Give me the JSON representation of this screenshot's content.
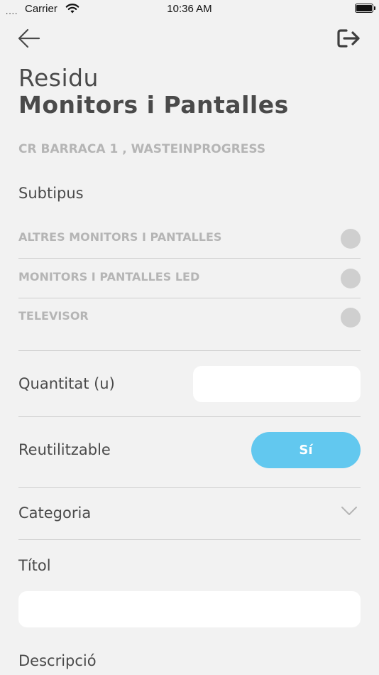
{
  "status_bar": {
    "signal": "....",
    "carrier": "Carrier",
    "time": "10:36 AM"
  },
  "header": {
    "back_icon": "arrow-left-icon",
    "logout_icon": "logout-icon"
  },
  "title": {
    "line1": "Residu",
    "line2": "Monitors i Pantalles"
  },
  "address": "CR BARRACA 1 , WASTEINPROGRESS",
  "subtypes": {
    "label": "Subtipus",
    "items": [
      {
        "label": "ALTRES MONITORS I PANTALLES",
        "selected": false
      },
      {
        "label": "MONITORS I PANTALLES LED",
        "selected": false
      },
      {
        "label": "TELEVISOR",
        "selected": false
      }
    ]
  },
  "quantity": {
    "label": "Quantitat (u)",
    "value": ""
  },
  "reusable": {
    "label": "Reutilitzable",
    "value": "Sí",
    "color": "#62c8ef"
  },
  "category": {
    "label": "Categoria",
    "icon": "chevron-down-icon"
  },
  "title_field": {
    "label": "Títol",
    "value": ""
  },
  "description": {
    "label": "Descripció"
  }
}
